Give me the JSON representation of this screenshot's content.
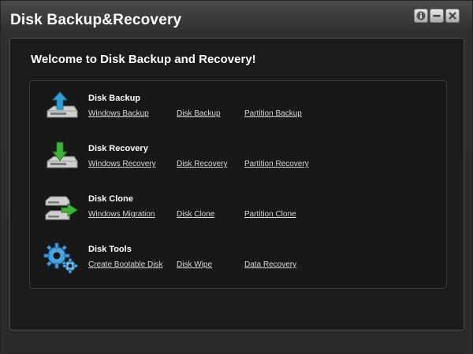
{
  "window": {
    "title": "Disk Backup&Recovery",
    "buttons": [
      "info-icon",
      "minimize-icon",
      "close-icon"
    ]
  },
  "main": {
    "welcome": "Welcome to Disk Backup and Recovery!",
    "sections": [
      {
        "title": "Disk Backup",
        "icon": "disk-backup-icon",
        "links": [
          "Windows Backup",
          "Disk Backup",
          "Partition Backup"
        ]
      },
      {
        "title": "Disk Recovery",
        "icon": "disk-recovery-icon",
        "links": [
          "Windows Recovery",
          "Disk Recovery",
          "Partition Recovery"
        ]
      },
      {
        "title": "Disk Clone",
        "icon": "disk-clone-icon",
        "links": [
          "Windows Migration",
          "Disk Clone",
          "Partition Clone"
        ]
      },
      {
        "title": "Disk Tools",
        "icon": "gears-icon",
        "links": [
          "Create Bootable Disk",
          "Disk Wipe",
          "Data Recovery"
        ]
      }
    ]
  },
  "colors": {
    "background": "#2b2b2b",
    "panel": "#1b1b1b",
    "text": "#ffffff",
    "link": "#d8d8d8",
    "arrow_blue": "#2f9fd6",
    "arrow_green": "#3db53a"
  }
}
